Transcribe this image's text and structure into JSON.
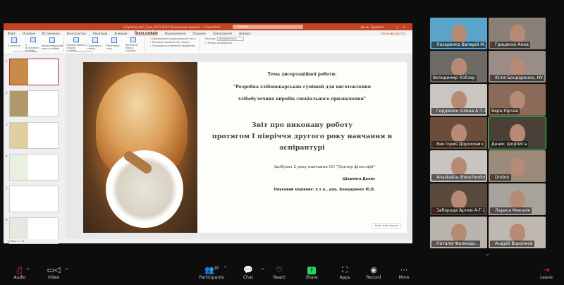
{
  "powerpoint": {
    "window_title": "Ціорпита_звіт_2 рік_2023-2024 [Захищений режим] — PowerPoint",
    "search_placeholder": "Пошук",
    "user": "Денис Ціорпита",
    "tabs": [
      "Файл",
      "Основне",
      "Вставлення",
      "Конструктор",
      "Переходи",
      "Анімація",
      "Показ слайдів",
      "Рецензування",
      "Подання",
      "Записування",
      "Довідка"
    ],
    "active_tab": "Показ слайдів",
    "share_label": "Спільний доступ",
    "ribbon": {
      "buttons": [
        "З початку",
        "З поточного слайда",
        "Користувацький показ слайдів",
        "Налаштування показу слайдів",
        "Приховати слайд",
        "Репетиція часу",
        "Записати показ слайдів"
      ],
      "checks": [
        "Відтворювати дикторський текст",
        "Використовувати час показу",
        "Показувати елементи керування"
      ],
      "monitor_label": "Монітор:",
      "monitor_value": "Автоматично",
      "presenter_view": "Режим доповідача",
      "groups": [
        "Почати показ слайдів",
        "Налаштування",
        "Монітори"
      ]
    },
    "thumbnails": [
      "1",
      "2",
      "3",
      "4",
      "5",
      "6"
    ],
    "status": "Слайд 1 з 13",
    "slide": {
      "topic_label": "Тема дисертаційної роботи:",
      "topic_line1": "\"Розробка хлібопекарських сумішей для виготовлення",
      "topic_line2": "хлібобулочних виробів спеціального призначення\"",
      "report_line1": "Звіт про виконану роботу",
      "report_line2": "протягом I півріччя другого року навчання в",
      "report_line3": "аспірантурі",
      "student": "Здобувач 2 року навчання ОС \"Доктор філософії\"",
      "name": "Ціорпита Денис",
      "supervisor": "Науковий керівник: к.т.н., доц. Бондаренко Ю.В.",
      "made_with": "Made with Gamma"
    }
  },
  "participants": [
    {
      "name": "Лазаренко Валерій М...",
      "muted": true,
      "bg": "#5aa3c9"
    },
    {
      "name": "Гриценко Анна",
      "muted": true,
      "bg": "#8a8078"
    },
    {
      "name": "Володимир Кобзар",
      "muted": false,
      "bg": "#6e6a66"
    },
    {
      "name": "Юлія Бондаренко, НУ...",
      "muted": true,
      "bg": "#9a8d88"
    },
    {
      "name": "Гордієнко Олена А-Т-1",
      "muted": true,
      "bg": "#c9c6c2"
    },
    {
      "name": "Вера Юрчак",
      "muted": false,
      "bg": "#8a6a58"
    },
    {
      "name": "Виктория Дорохович",
      "muted": true,
      "bg": "#6b4e3a"
    },
    {
      "name": "Денис Ціорпита",
      "muted": false,
      "bg": "#4a4038",
      "active": true
    },
    {
      "name": "Anastasiia Shevchenko",
      "muted": true,
      "bg": "#c8c4c0"
    },
    {
      "name": "Drebot",
      "muted": true,
      "bg": "#9c8a7a"
    },
    {
      "name": "Заборода Артем А-Т-1",
      "muted": true,
      "bg": "#5a4a3e"
    },
    {
      "name": "Лариса Миконік",
      "muted": true,
      "bg": "#a8a29c"
    },
    {
      "name": "Наталія Фаленди...",
      "muted": true,
      "bg": "#b9b4ae"
    },
    {
      "name": "Андрій Воронков",
      "muted": true,
      "bg": "#bfb8b0"
    }
  ],
  "toolbar": {
    "audio": "Audio",
    "video": "Video",
    "participants": "Participants",
    "participants_count": "18",
    "chat": "Chat",
    "react": "React",
    "share": "Share",
    "apps": "Apps",
    "record": "Record",
    "more": "More",
    "leave": "Leave"
  },
  "colors": {
    "ppt_accent": "#c2431f",
    "active_speaker": "#23d959",
    "share": "#23d959",
    "muted": "#e02828"
  }
}
